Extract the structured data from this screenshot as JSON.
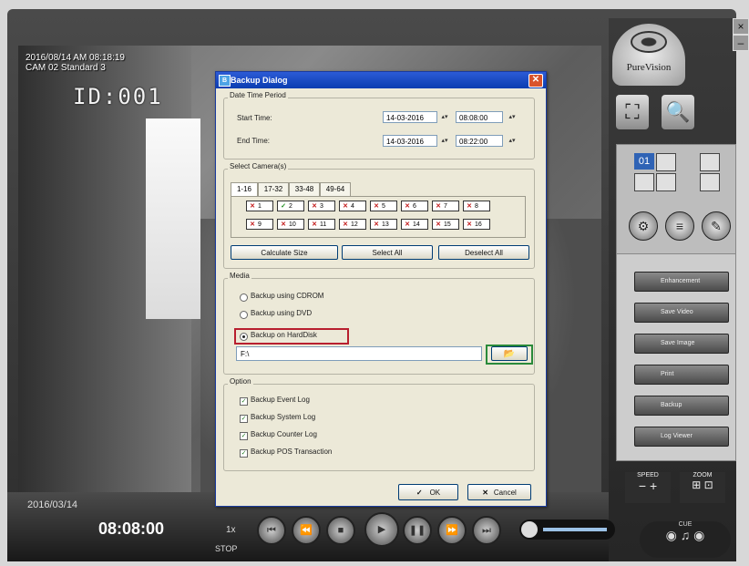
{
  "osd": {
    "timestamp": "2016/08/14 AM 08:18:19",
    "camera_name": "CAM 02 Standard 3",
    "cam_id": "ID:001"
  },
  "brand": {
    "name": "PureVision"
  },
  "window_controls": {
    "close": "×",
    "minimize": "–"
  },
  "view": {
    "grid_selected": "01"
  },
  "functions": [
    {
      "label": "Enhancement",
      "icon": "enhancement-icon"
    },
    {
      "label": "Save Video",
      "icon": "video-icon"
    },
    {
      "label": "Save Image",
      "icon": "image-icon"
    },
    {
      "label": "Print",
      "icon": "printer-icon"
    },
    {
      "label": "Backup",
      "icon": "backup-icon"
    },
    {
      "label": "Log Viewer",
      "icon": "log-icon"
    }
  ],
  "controls": {
    "speed_label": "SPEED",
    "zoom_label": "ZOOM",
    "cue_label": "CUE"
  },
  "playback": {
    "date": "2016/03/14",
    "time": "08:08:00",
    "speed": "1x",
    "state": "STOP"
  },
  "dialog": {
    "title": "Backup Dialog",
    "date_group": "Date Time Period",
    "start_label": "Start Time:",
    "start_date": "14-03-2016",
    "start_time": "08:08:00",
    "end_label": "End Time:",
    "end_date": "14-03-2016",
    "end_time": "08:22:00",
    "camera_group": "Select Camera(s)",
    "tabs": [
      "1-16",
      "17-32",
      "33-48",
      "49-64"
    ],
    "cameras": [
      {
        "num": "1",
        "checked": false
      },
      {
        "num": "2",
        "checked": true
      },
      {
        "num": "3",
        "checked": false
      },
      {
        "num": "4",
        "checked": false
      },
      {
        "num": "5",
        "checked": false
      },
      {
        "num": "6",
        "checked": false
      },
      {
        "num": "7",
        "checked": false
      },
      {
        "num": "8",
        "checked": false
      },
      {
        "num": "9",
        "checked": false
      },
      {
        "num": "10",
        "checked": false
      },
      {
        "num": "11",
        "checked": false
      },
      {
        "num": "12",
        "checked": false
      },
      {
        "num": "13",
        "checked": false
      },
      {
        "num": "14",
        "checked": false
      },
      {
        "num": "15",
        "checked": false
      },
      {
        "num": "16",
        "checked": false
      }
    ],
    "calculate_size": "Calculate Size",
    "select_all": "Select All",
    "deselect_all": "Deselect All",
    "media_group": "Media",
    "media_cdrom": "Backup using CDROM",
    "media_dvd": "Backup using DVD",
    "media_harddisk": "Backup on HardDisk",
    "media_selected": "harddisk",
    "path": "F:\\",
    "option_group": "Option",
    "options": [
      {
        "label": "Backup Event Log",
        "checked": true
      },
      {
        "label": "Backup System Log",
        "checked": true
      },
      {
        "label": "Backup Counter Log",
        "checked": true
      },
      {
        "label": "Backup POS Transaction",
        "checked": true
      }
    ],
    "ok": "OK",
    "cancel": "Cancel"
  }
}
